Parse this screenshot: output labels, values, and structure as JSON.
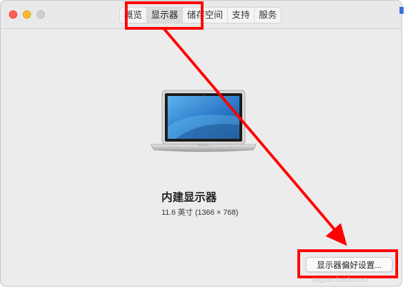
{
  "tabs": [
    {
      "label": "概览",
      "active": false
    },
    {
      "label": "显示器",
      "active": true
    },
    {
      "label": "储存空间",
      "active": false
    },
    {
      "label": "支持",
      "active": false
    },
    {
      "label": "服务",
      "active": false
    }
  ],
  "display": {
    "name": "内建显示器",
    "spec": "11.6 英寸 (1366 × 768)"
  },
  "buttons": {
    "preferences": "显示器偏好设置..."
  },
  "watermark": "jingyan.baidu.com",
  "colors": {
    "annotation": "#ff0000",
    "close": "#fe5f57",
    "minimize": "#febc2e",
    "zoom_disabled": "#cfcfcf"
  },
  "icons": {
    "laptop": "macbook-air-laptop-icon"
  }
}
